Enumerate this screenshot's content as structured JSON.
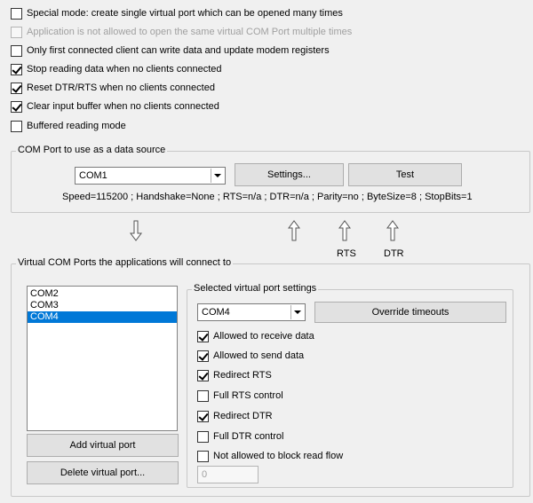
{
  "options": [
    {
      "label": "Special mode: create single virtual port which can be opened many times",
      "checked": false,
      "disabled": false
    },
    {
      "label": "Application is not allowed to open the same virtual COM Port multiple times",
      "checked": false,
      "disabled": true
    },
    {
      "label": "Only first connected client can write data and update modem registers",
      "checked": false,
      "disabled": false
    },
    {
      "label": "Stop reading data when no clients connected",
      "checked": true,
      "disabled": false
    },
    {
      "label": "Reset DTR/RTS when no clients connected",
      "checked": true,
      "disabled": false
    },
    {
      "label": "Clear input buffer when no clients connected",
      "checked": true,
      "disabled": false
    },
    {
      "label": "Buffered reading mode",
      "checked": false,
      "disabled": false
    }
  ],
  "source": {
    "group_label": "COM Port to use as a data source",
    "port_value": "COM1",
    "settings_label": "Settings...",
    "test_label": "Test",
    "status": "Speed=115200 ; Handshake=None ; RTS=n/a ; DTR=n/a ; Parity=no ; ByteSize=8 ; StopBits=1"
  },
  "signals": {
    "rts": "RTS",
    "dtr": "DTR"
  },
  "virtual": {
    "group_label": "Virtual COM Ports the applications will connect to",
    "ports": [
      "COM2",
      "COM3",
      "COM4"
    ],
    "selected_index": 2,
    "add_label": "Add virtual port",
    "delete_label": "Delete virtual port..."
  },
  "selected": {
    "group_label": "Selected virtual port settings",
    "port_value": "COM4",
    "override_label": "Override timeouts",
    "options": [
      {
        "label": "Allowed to receive data",
        "checked": true
      },
      {
        "label": "Allowed to send data",
        "checked": true
      },
      {
        "label": "Redirect RTS",
        "checked": true
      },
      {
        "label": "Full RTS control",
        "checked": false
      },
      {
        "label": "Redirect DTR",
        "checked": true
      },
      {
        "label": "Full DTR control",
        "checked": false
      },
      {
        "label": "Not allowed to block read flow",
        "checked": false
      }
    ],
    "timeout_value": "0"
  }
}
